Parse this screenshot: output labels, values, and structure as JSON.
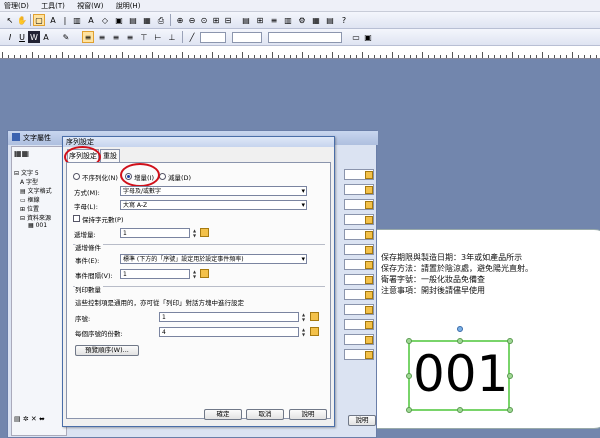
{
  "menubar": {
    "items": [
      "管理(D)",
      "工具(T)",
      "視窗(W)",
      "說明(H)"
    ]
  },
  "workspace": {
    "label_lines": [
      "保存期限與製造日期：3年或如產品所示",
      "保存方法：請置於陰涼處，避免陽光直射。",
      "衛署字號：一般化妝品免備查",
      "注意事項：開封後請儘早使用"
    ],
    "serial_value": "001"
  },
  "text_window": {
    "title": "文字屬性",
    "tree": {
      "root": "文字 5",
      "font": "字型",
      "format": "文字格式",
      "frame": "框線",
      "position": "位置",
      "data_source": "資料來源",
      "serial": "001"
    },
    "help_button": "說明"
  },
  "dialog": {
    "title": "序列設定",
    "tabs": [
      "序列設定",
      "重設"
    ],
    "radio": {
      "none": "不序列化(N)",
      "increment": "增量(I)",
      "decrement": "減量(D)",
      "selected": "increment"
    },
    "method_label": "方式(M):",
    "method_value": "字母及/或數字",
    "letters_label": "字母(L):",
    "letters_value": "大寫 A-Z",
    "keep_zero_label": "保持字元數(P)",
    "step_label": "遞增量:",
    "step_value": "1",
    "trigger_group": "遞增條件",
    "event_label": "事件(E):",
    "event_value": "標準 (下方的「序號」設定用於設定事件頻率)",
    "event_interval_label": "事件間隔(V):",
    "event_interval_value": "1",
    "count_group": "列印數量",
    "count_desc": "這些控制項是通用的，亦可從「列印」對話方塊中進行設定",
    "serial_label": "序號:",
    "serial_value": "1",
    "copies_label": "每個序號的份數:",
    "copies_value": "4",
    "preview_button": "預覽順序(W)...",
    "ok_button": "確定",
    "cancel_button": "取消",
    "help_button": "說明"
  },
  "colors": {
    "workspace": "#7286ad",
    "highlight_circle": "#d0101a",
    "selection": "#79d46a"
  }
}
